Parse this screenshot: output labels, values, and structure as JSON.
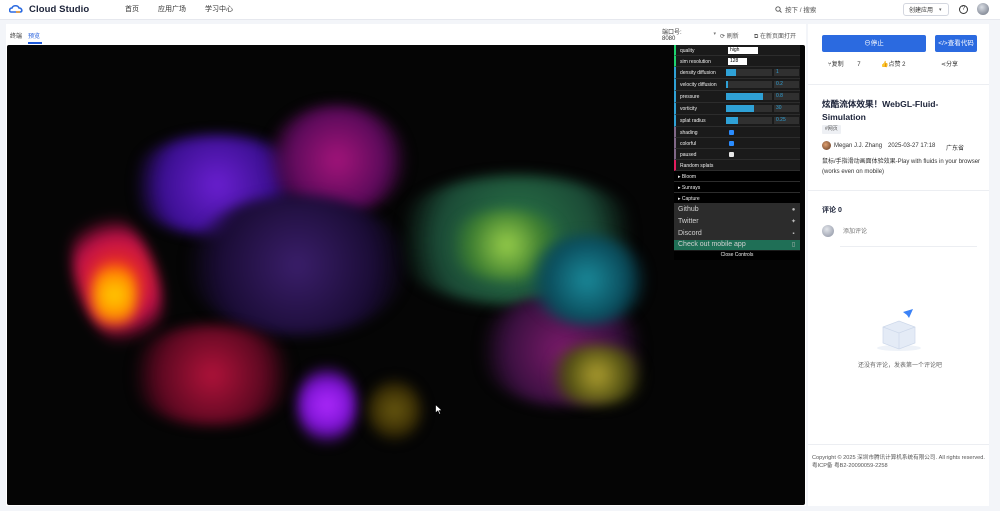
{
  "topbar": {
    "logo_text": "Cloud Studio",
    "nav": [
      "首页",
      "应用广场",
      "学习中心"
    ],
    "search_text": "按下 / 搜索",
    "create_label": "创建应用"
  },
  "workspace": {
    "tabs": [
      "终端",
      "预览"
    ],
    "port_label": "端口号: 8080",
    "refresh_label": "刷新",
    "open_new_label": "在新页面打开"
  },
  "controls": {
    "quality_label": "quality",
    "quality_value": "high",
    "sim_resolution_label": "sim resolution",
    "sim_resolution_value": "128",
    "sliders": [
      {
        "label": "density diffusion",
        "value": "1",
        "fill": 0.22
      },
      {
        "label": "velocity diffusion",
        "value": "0.2",
        "fill": 0.05
      },
      {
        "label": "pressure",
        "value": "0.8",
        "fill": 0.8
      },
      {
        "label": "vorticity",
        "value": "30",
        "fill": 0.6
      },
      {
        "label": "splat radius",
        "value": "0.25",
        "fill": 0.25
      }
    ],
    "checkboxes": [
      {
        "label": "shading",
        "checked": true
      },
      {
        "label": "colorful",
        "checked": true
      },
      {
        "label": "paused",
        "checked": false
      }
    ],
    "random_splats_label": "Random splats",
    "folders": [
      "Bloom",
      "Sunrays",
      "Capture"
    ],
    "links": [
      "Github",
      "Twitter",
      "Discord",
      "Check out mobile app"
    ],
    "close_label": "Close Controls"
  },
  "sidebar": {
    "stop_label": "停止",
    "view_code_label": "查看代码",
    "copy_label": "复制",
    "copy_count": "7",
    "like_label": "点赞",
    "like_count": "2",
    "share_label": "分享",
    "title": "炫酷流体效果！WebGL-Fluid-Simulation",
    "tag": "#网页",
    "author": "Megan J.J. Zhang",
    "date": "2025-03-27 17:18",
    "region": "广东省",
    "description": "鼠标/手指滑动画面体验效果-Play with fluids in your browser (works even on mobile)",
    "comments_title": "评论 0",
    "comment_placeholder": "添加评论",
    "empty_text": "还没有评论，发表第一个评论吧",
    "copyright": "Copyright © 2025 深圳市腾讯计算机系统有限公司. All rights reserved. 粤ICP备 粤B2-20090059-2258"
  }
}
